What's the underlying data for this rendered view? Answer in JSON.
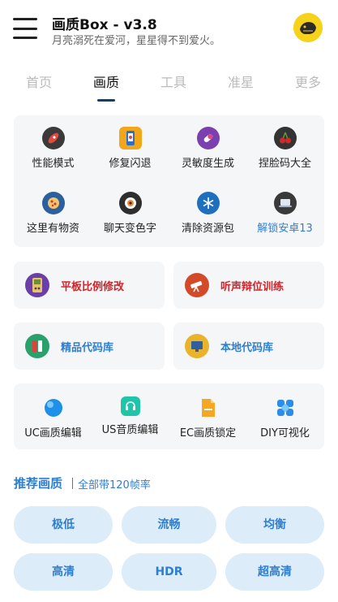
{
  "header": {
    "title": "画质Box - v3.8",
    "subtitle": "月亮溺死在爱河，星星得不到爱火。"
  },
  "tabs": [
    {
      "label": "首页"
    },
    {
      "label": "画质"
    },
    {
      "label": "工具"
    },
    {
      "label": "准星"
    },
    {
      "label": "更多"
    }
  ],
  "grid1": [
    {
      "label": "性能模式",
      "icon": "rocket-icon"
    },
    {
      "label": "修复闪退",
      "icon": "phone-repair-icon"
    },
    {
      "label": "灵敏度生成",
      "icon": "pill-icon"
    },
    {
      "label": "捏脸码大全",
      "icon": "cherry-icon"
    },
    {
      "label": "这里有物资",
      "icon": "pizza-icon"
    },
    {
      "label": "聊天变色字",
      "icon": "sushi-icon"
    },
    {
      "label": "清除资源包",
      "icon": "snowflake-icon"
    },
    {
      "label": "解锁安卓13",
      "icon": "laptop-icon"
    }
  ],
  "wide_cards": [
    {
      "label": "平板比例修改",
      "icon": "gameboy-icon"
    },
    {
      "label": "听声辩位训练",
      "icon": "telescope-icon"
    },
    {
      "label": "精品代码库",
      "icon": "battery-icon"
    },
    {
      "label": "本地代码库",
      "icon": "monitor-icon"
    }
  ],
  "grid2": [
    {
      "label": "UC画质编辑",
      "icon": "sphere-icon"
    },
    {
      "label": "US音质编辑",
      "icon": "headset-icon"
    },
    {
      "label": "EC画质锁定",
      "icon": "document-icon"
    },
    {
      "label": "DIY可视化",
      "icon": "diamond-icon"
    }
  ],
  "quality_section": {
    "title": "推荐画质",
    "note": "全部带120帧率",
    "options": [
      {
        "label": "极低"
      },
      {
        "label": "流畅"
      },
      {
        "label": "均衡"
      },
      {
        "label": "高清"
      },
      {
        "label": "HDR"
      },
      {
        "label": "超高清"
      }
    ]
  },
  "colors": {
    "accent_blue": "#2d7fd2",
    "accent_red": "#d2232a",
    "pill_bg": "#dcecf8",
    "card_bg": "#f5f6f7"
  }
}
